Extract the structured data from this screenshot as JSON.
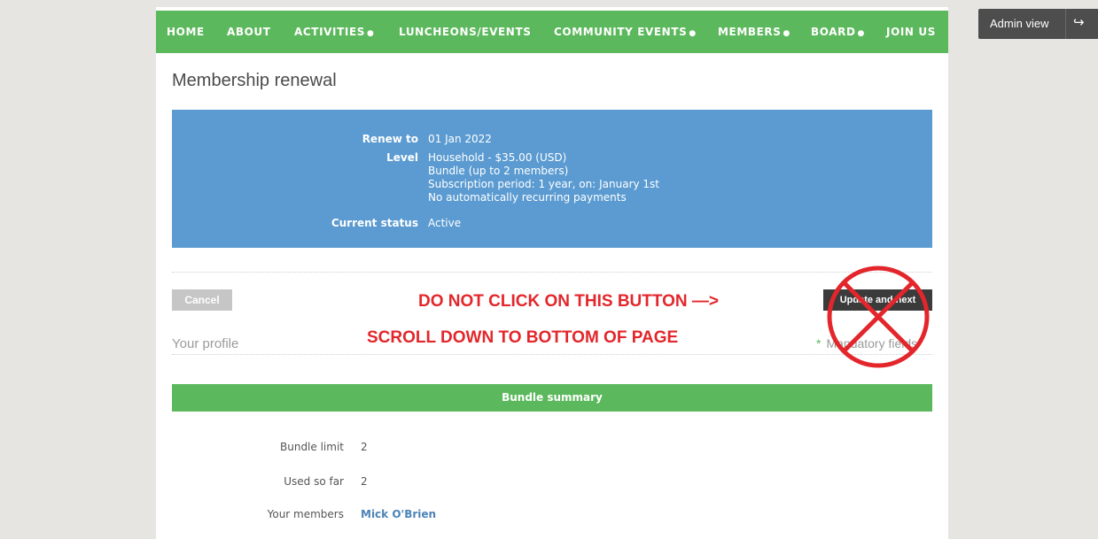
{
  "nav": {
    "items": [
      {
        "label": "HOME",
        "dot": ""
      },
      {
        "label": "ABOUT",
        "dot": ""
      },
      {
        "label": "ACTIVITIES",
        "dot": "●"
      },
      {
        "label": "LUNCHEONS/EVENTS",
        "dot": ""
      },
      {
        "label": "COMMUNITY EVENTS",
        "dot": "●"
      },
      {
        "label": "MEMBERS",
        "dot": "●"
      },
      {
        "label": "BOARD",
        "dot": "●"
      },
      {
        "label": "JOIN US",
        "dot": ""
      }
    ]
  },
  "admin": {
    "label": "Admin view",
    "exit_icon": "↪"
  },
  "page": {
    "title": "Membership renewal"
  },
  "renewal": {
    "renew_to_label": "Renew to",
    "renew_to_value": "01 Jan 2022",
    "level_label": "Level",
    "level_lines": [
      "Household - $35.00 (USD)",
      "Bundle (up to 2 members)",
      "Subscription period: 1 year, on: January 1st",
      "No automatically recurring payments"
    ],
    "status_label": "Current status",
    "status_value": "Active"
  },
  "actions": {
    "cancel_label": "Cancel",
    "update_label": "Update and next"
  },
  "annotation": {
    "line1": "DO NOT CLICK ON THIS BUTTON —>",
    "line2": "SCROLL DOWN TO BOTTOM OF PAGE"
  },
  "profile": {
    "title": "Your profile",
    "mandatory_star": "*",
    "mandatory_label": "Mandatory fields"
  },
  "bundle": {
    "header": "Bundle summary",
    "limit_label": "Bundle limit",
    "limit_value": "2",
    "used_label": "Used so far",
    "used_value": "2",
    "members_label": "Your members",
    "members_value": "Mick O'Brien"
  },
  "colors": {
    "nav_green": "#5cb85c",
    "info_blue": "#5b9bd1",
    "warning_red": "#e3262b",
    "admin_dark": "#4d4d4d"
  }
}
